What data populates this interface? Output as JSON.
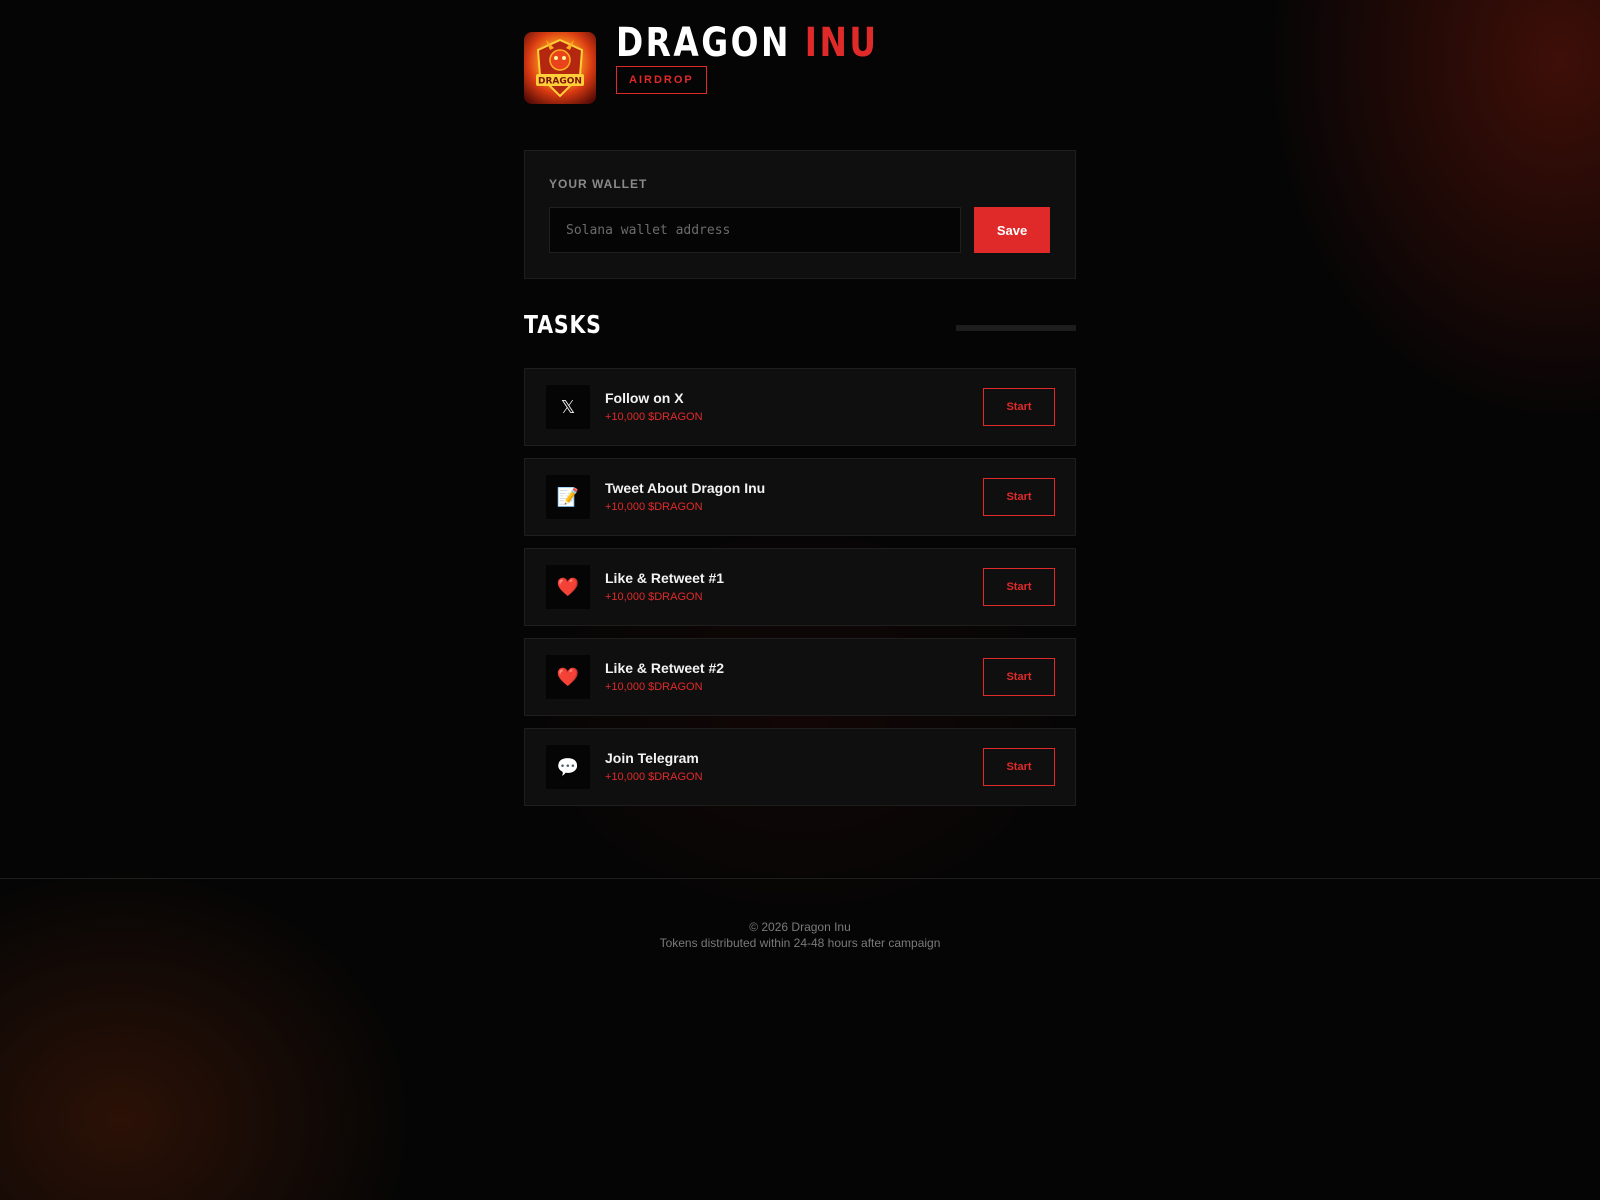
{
  "brand": {
    "title_main": "DRAGON",
    "title_accent": "INU",
    "badge": "AIRDROP",
    "logo_text": "DRAGON"
  },
  "wallet": {
    "label": "YOUR WALLET",
    "input_value": "",
    "placeholder": "Solana wallet address",
    "save_label": "Save"
  },
  "tasks": {
    "title": "TASKS",
    "progress": 0,
    "items": [
      {
        "icon": "x-icon",
        "glyph": "𝕏",
        "name": "Follow on X",
        "reward": "+10,000 $DRAGON",
        "action": "Start"
      },
      {
        "icon": "memo-icon",
        "glyph": "📝",
        "name": "Tweet About Dragon Inu",
        "reward": "+10,000 $DRAGON",
        "action": "Start"
      },
      {
        "icon": "heart-icon",
        "glyph": "❤️",
        "name": "Like & Retweet #1",
        "reward": "+10,000 $DRAGON",
        "action": "Start"
      },
      {
        "icon": "heart-icon",
        "glyph": "❤️",
        "name": "Like & Retweet #2",
        "reward": "+10,000 $DRAGON",
        "action": "Start"
      },
      {
        "icon": "speech-bubble-icon",
        "glyph": "💬",
        "name": "Join Telegram",
        "reward": "+10,000 $DRAGON",
        "action": "Start"
      }
    ]
  },
  "footer": {
    "copyright": "© 2026 Dragon Inu",
    "note": "Tokens distributed within 24-48 hours after campaign"
  },
  "colors": {
    "accent": "#e02a2a",
    "background": "#050505",
    "card": "#0f0f0f"
  }
}
